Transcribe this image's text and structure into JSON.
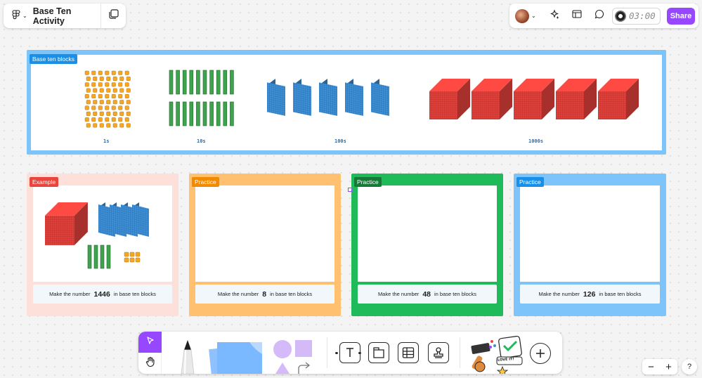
{
  "header": {
    "file_title": "Base Ten Activity",
    "menu_icon": "figjam-logo-icon",
    "pages_icon": "pages-icon"
  },
  "right_toolbar": {
    "timer": "03:00",
    "share_label": "Share",
    "icons": [
      "ai-sparkle-icon",
      "layout-icon",
      "comment-icon"
    ]
  },
  "section": {
    "label": "Base ten blocks",
    "block_labels": [
      "1s",
      "10s",
      "100s",
      "1000s"
    ],
    "colors": {
      "ones": "#f5a623",
      "tens": "#3fa34d",
      "hundreds": "#3d8fd6",
      "thousands": "#e0403a"
    }
  },
  "frames": [
    {
      "label": "Example",
      "label_color": "#e8453c",
      "bg": "#fde0d9",
      "instr_bg": "#f2f7fb",
      "instr_pre": "Make the number",
      "number": "1446",
      "instr_post": "in base ten blocks"
    },
    {
      "label": "Practice",
      "label_color": "#f08a00",
      "bg": "#ffc170",
      "instr_bg": "#f2f7fb",
      "instr_pre": "Make the number",
      "number": "8",
      "instr_post": "in base ten blocks"
    },
    {
      "label": "Practice",
      "label_color": "#157a37",
      "bg": "#1fbb5a",
      "instr_bg": "#f2f7fb",
      "instr_pre": "Make the number",
      "number": "48",
      "instr_post": "in base ten blocks"
    },
    {
      "label": "Practice",
      "label_color": "#1a8fe8",
      "bg": "#7cc4fa",
      "instr_bg": "#f2f7fb",
      "instr_pre": "Make the number",
      "number": "126",
      "instr_post": "in base ten blocks"
    }
  ],
  "bottom_toolbar": {
    "tools": [
      "select-tool",
      "hand-tool",
      "marker-tool",
      "sticky-note-tool",
      "shapes-tool",
      "text-tool",
      "section-tool",
      "table-tool",
      "stamp-tool",
      "stickers-tool",
      "more-tool"
    ],
    "sticker_text": "LOVE IT!"
  },
  "zoom": {
    "minus": "−",
    "plus": "+"
  },
  "help": "?"
}
